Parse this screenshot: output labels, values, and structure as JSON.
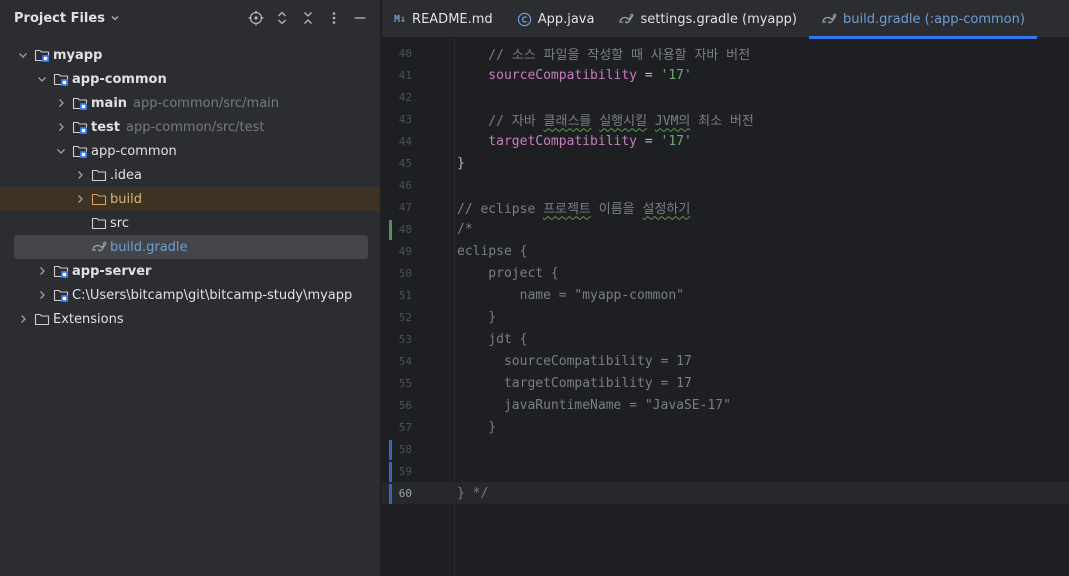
{
  "panel": {
    "title": "Project Files"
  },
  "tree": [
    {
      "depth": 0,
      "arrow": "down",
      "icon": "module-folder",
      "label": "myapp",
      "bold": true
    },
    {
      "depth": 1,
      "arrow": "down",
      "icon": "module-folder",
      "label": "app-common",
      "bold": true
    },
    {
      "depth": 2,
      "arrow": "right",
      "icon": "module-folder",
      "label": "main",
      "bold": true,
      "path": "app-common/src/main"
    },
    {
      "depth": 2,
      "arrow": "right",
      "icon": "module-folder",
      "label": "test",
      "bold": true,
      "path": "app-common/src/test"
    },
    {
      "depth": 2,
      "arrow": "down",
      "icon": "module-folder",
      "label": "app-common"
    },
    {
      "depth": 3,
      "arrow": "right",
      "icon": "folder",
      "label": ".idea"
    },
    {
      "depth": 3,
      "arrow": "right",
      "icon": "folder-orange",
      "label": "build",
      "style": "orange"
    },
    {
      "depth": 3,
      "arrow": "none",
      "icon": "folder",
      "label": "src"
    },
    {
      "depth": 3,
      "arrow": "none",
      "icon": "gradle",
      "label": "build.gradle",
      "style": "blue",
      "selected": true
    },
    {
      "depth": 1,
      "arrow": "right",
      "icon": "module-folder",
      "label": "app-server",
      "bold": true
    },
    {
      "depth": 1,
      "arrow": "right",
      "icon": "module-folder",
      "label": "C:\\Users\\bitcamp\\git\\bitcamp-study\\myapp"
    },
    {
      "depth": 0,
      "arrow": "right",
      "icon": "folder",
      "label": "Extensions"
    }
  ],
  "tabs": [
    {
      "icon": "markdown-icon",
      "label": "README.md"
    },
    {
      "icon": "java-class-icon",
      "label": "App.java"
    },
    {
      "icon": "gradle-icon",
      "label": "settings.gradle (myapp)"
    },
    {
      "icon": "gradle-icon",
      "label": "build.gradle (:app-common)",
      "active": true
    }
  ],
  "editor": {
    "current_line": 60,
    "lines": [
      {
        "n": 40,
        "tokens": [
          [
            "comment",
            "    // 소스 파일을 작성할 때 사용할 자바 버전"
          ]
        ]
      },
      {
        "n": 41,
        "tokens": [
          [
            "prop",
            "    sourceCompatibility"
          ],
          [
            "plain",
            " = "
          ],
          [
            "str",
            "'17'"
          ]
        ]
      },
      {
        "n": 42,
        "tokens": []
      },
      {
        "n": 43,
        "tokens": [
          [
            "comment",
            "    // 자바 "
          ],
          [
            "comment-squig",
            "클래스를"
          ],
          [
            "comment",
            " "
          ],
          [
            "comment-squig",
            "실행시킬"
          ],
          [
            "comment",
            " "
          ],
          [
            "comment-squig",
            "JVM의"
          ],
          [
            "comment",
            " 최소 버전"
          ]
        ]
      },
      {
        "n": 44,
        "tokens": [
          [
            "prop",
            "    targetCompatibility"
          ],
          [
            "plain",
            " = "
          ],
          [
            "str",
            "'17'"
          ]
        ]
      },
      {
        "n": 45,
        "tokens": [
          [
            "plain",
            "}"
          ]
        ]
      },
      {
        "n": 46,
        "tokens": []
      },
      {
        "n": 47,
        "tokens": [
          [
            "comment",
            "// eclipse "
          ],
          [
            "comment-squig",
            "프로젝트"
          ],
          [
            "comment",
            " 이름을 "
          ],
          [
            "comment-squig",
            "설정하기"
          ]
        ]
      },
      {
        "n": 48,
        "tokens": [
          [
            "comment",
            "/*"
          ]
        ],
        "marker": "green"
      },
      {
        "n": 49,
        "tokens": [
          [
            "comment",
            "eclipse {"
          ]
        ]
      },
      {
        "n": 50,
        "tokens": [
          [
            "comment",
            "    project {"
          ]
        ]
      },
      {
        "n": 51,
        "tokens": [
          [
            "comment",
            "        name = \"myapp-common\""
          ]
        ]
      },
      {
        "n": 52,
        "tokens": [
          [
            "comment",
            "    }"
          ]
        ]
      },
      {
        "n": 53,
        "tokens": [
          [
            "comment",
            "    jdt {"
          ]
        ]
      },
      {
        "n": 54,
        "tokens": [
          [
            "comment",
            "      sourceCompatibility = 17"
          ]
        ]
      },
      {
        "n": 55,
        "tokens": [
          [
            "comment",
            "      targetCompatibility = 17"
          ]
        ]
      },
      {
        "n": 56,
        "tokens": [
          [
            "comment",
            "      javaRuntimeName = \"JavaSE-17\""
          ]
        ]
      },
      {
        "n": 57,
        "tokens": [
          [
            "comment",
            "    }"
          ]
        ]
      },
      {
        "n": 58,
        "tokens": [],
        "marker": "blue"
      },
      {
        "n": 59,
        "tokens": [],
        "marker": "blue"
      },
      {
        "n": 60,
        "tokens": [
          [
            "comment",
            "} */"
          ]
        ],
        "marker": "blue"
      }
    ]
  },
  "colors": {
    "accent": "#3574f0",
    "comment": "#7a7e85",
    "property": "#c77dbb",
    "string": "#6aab73",
    "selection": "#43454a"
  }
}
